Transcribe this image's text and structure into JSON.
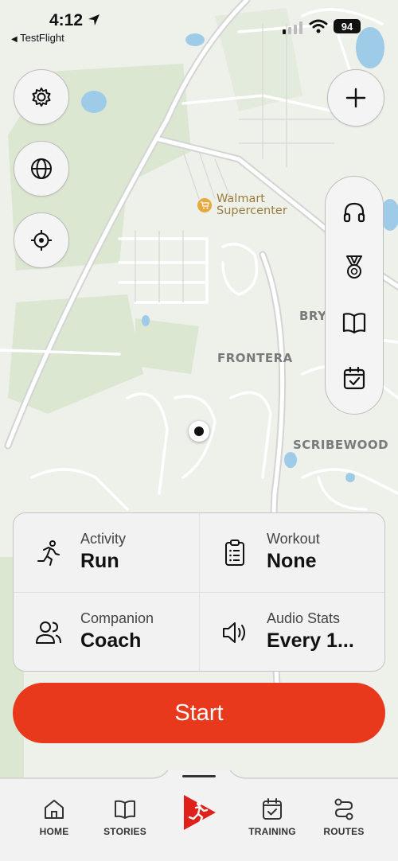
{
  "status_bar": {
    "time": "4:12",
    "back_app": "TestFlight",
    "battery": "94"
  },
  "map": {
    "poi": {
      "name_line1": "Walmart",
      "name_line2": "Supercenter"
    },
    "labels": [
      "FRONTERA",
      "SCRIBEWOOD",
      "BRY"
    ]
  },
  "left_controls": [
    {
      "icon": "gear-icon"
    },
    {
      "icon": "globe-icon"
    },
    {
      "icon": "crosshair-icon"
    }
  ],
  "add_button": {
    "icon": "plus-icon"
  },
  "right_pill": [
    {
      "icon": "headphones-icon"
    },
    {
      "icon": "medal-icon"
    },
    {
      "icon": "book-icon"
    },
    {
      "icon": "calendar-check-icon"
    }
  ],
  "settings_card": {
    "activity": {
      "label": "Activity",
      "value": "Run"
    },
    "workout": {
      "label": "Workout",
      "value": "None"
    },
    "companion": {
      "label": "Companion",
      "value": "Coach"
    },
    "audio_stats": {
      "label": "Audio Stats",
      "value": "Every 1..."
    }
  },
  "start_button": {
    "label": "Start"
  },
  "tabs": [
    {
      "label": "HOME"
    },
    {
      "label": "STORIES"
    },
    {
      "label": ""
    },
    {
      "label": "TRAINING"
    },
    {
      "label": "ROUTES"
    }
  ],
  "colors": {
    "accent": "#e9391d",
    "map_bg": "#eef0ea",
    "park": "#d9e6cf",
    "water": "#9ecbe8"
  }
}
